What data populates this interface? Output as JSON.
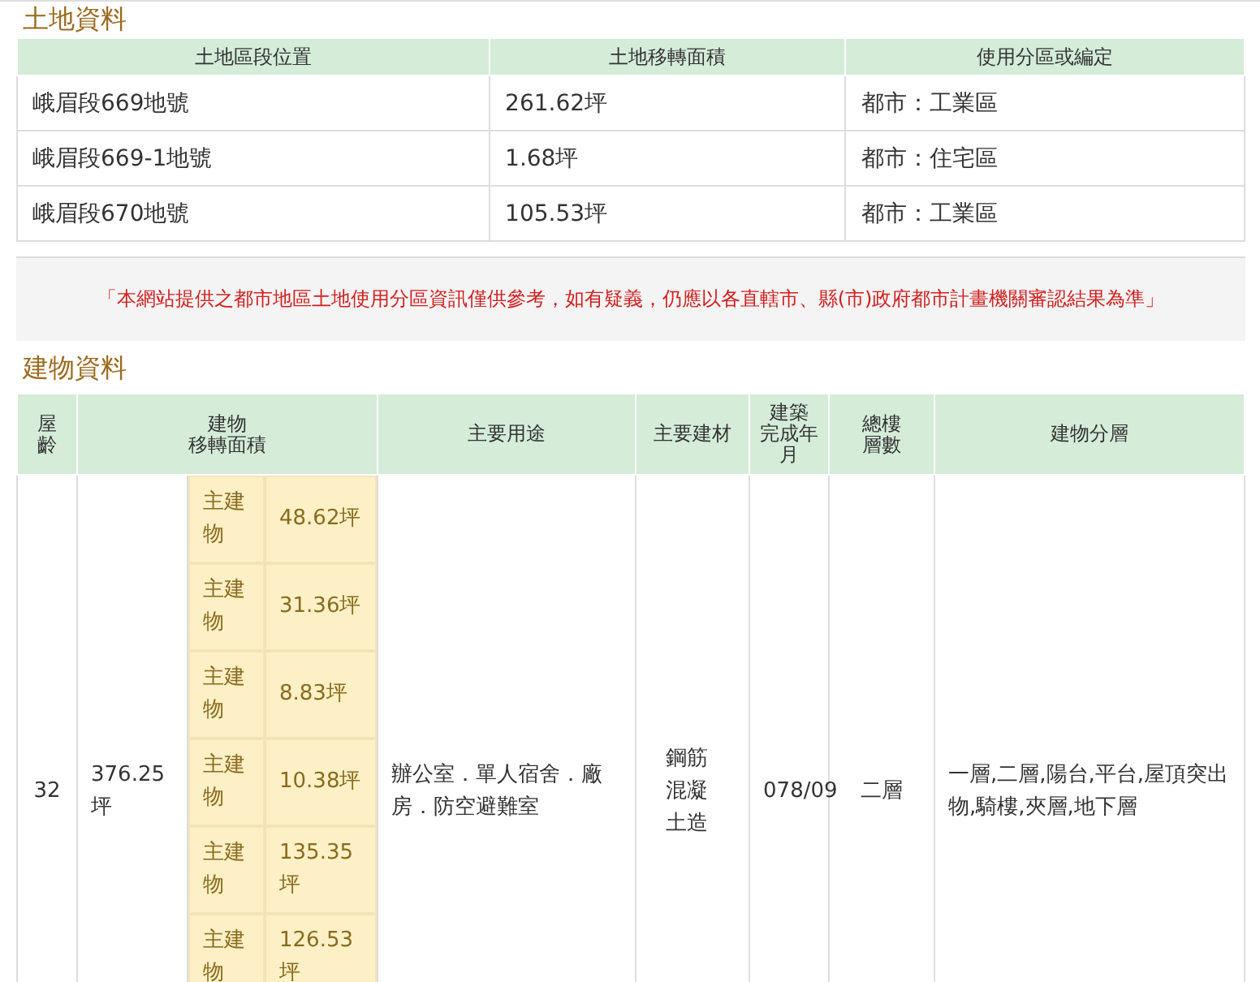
{
  "land": {
    "title": "土地資料",
    "columns": [
      "土地區段位置",
      "土地移轉面積",
      "使用分區或編定"
    ],
    "rows": [
      [
        "峨眉段669地號",
        "261.62坪",
        "都市：工業區"
      ],
      [
        "峨眉段669-1地號",
        "1.68坪",
        "都市：住宅區"
      ],
      [
        "峨眉段670地號",
        "105.53坪",
        "都市：工業區"
      ]
    ]
  },
  "notice": "「本網站提供之都市地區土地使用分區資訊僅供參考，如有疑義，仍應以各直轄市、縣(市)政府都市計畫機關審認結果為準」",
  "building": {
    "title": "建物資料",
    "columns": [
      [
        "屋",
        "齡"
      ],
      [
        "建物",
        "移轉面積"
      ],
      [
        "主要用途"
      ],
      [
        "主要建材"
      ],
      [
        "建築",
        "完成年",
        "月"
      ],
      [
        "總樓",
        "層數"
      ],
      [
        "建物分層"
      ]
    ],
    "row": {
      "age": "32",
      "area": "376.25坪",
      "usage": "辦公室．單人宿舍．廠房．防空避難室",
      "material": "鋼筋混凝土造",
      "completed": "078/09",
      "floors": "二層",
      "layers": "一層,二層,陽台,平台,屋頂突出物,騎樓,夾層,地下層",
      "parts": [
        {
          "type": "主建物",
          "area": "48.62坪"
        },
        {
          "type": "主建物",
          "area": "31.36坪"
        },
        {
          "type": "主建物",
          "area": "8.83坪"
        },
        {
          "type": "主建物",
          "area": "10.38坪"
        },
        {
          "type": "主建物",
          "area": "135.35坪"
        },
        {
          "type": "主建物",
          "area": "126.53坪"
        }
      ]
    }
  }
}
